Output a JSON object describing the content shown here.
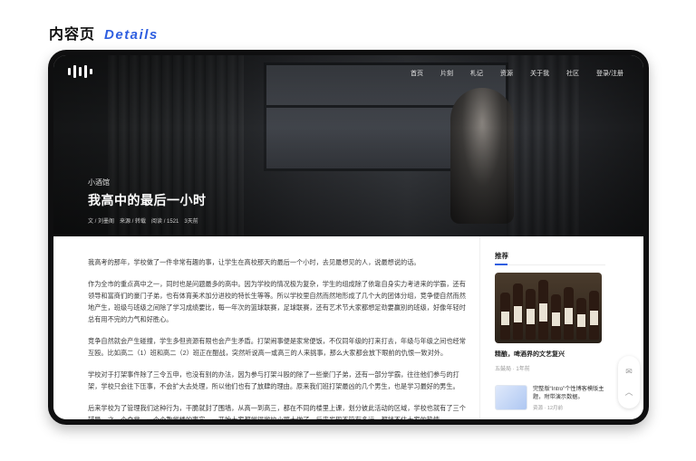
{
  "page_heading": {
    "cn": "内容页",
    "en": "Details"
  },
  "nav": {
    "items": [
      "首页",
      "片刻",
      "札记",
      "资源",
      "关于我",
      "社区",
      "登录/注册"
    ]
  },
  "hero": {
    "category": "小酒馆",
    "title": "我高中的最后一小时",
    "meta": [
      "文 / 刘墨阁",
      "来源 / 转载",
      "阅读 / 1521",
      "3天前"
    ]
  },
  "article": {
    "paragraphs": [
      "我高考的那年，学校做了一件非常有趣的事，让学生在高校那天的最后一个小时，去见最想见的人，说最想说的话。",
      "作为全市的重点高中之一，同时也是问题最多的高中。因为学校的情况极为复杂，学生的组成除了依靠自身实力考进来的学霸，还有领导和富商们的豪门子弟，也有体育美术加分进校的特长生等等。所以学校里自然而然地形成了几个大的团体分组，竞争便自然而然地产生，班级与班级之间除了学习成绩要比，每一年次的篮球联赛，足球联赛，还有艺术节大家都想足劲要赢别的班级，好像年轻时总有用不完的力气和好胜心。",
      "竞争自然就会产生碰撞，学生多但资源有限也会产生矛盾。打架闹事便是家常便饭，不仅同年级的打来打去，年级与年级之间也经常互殴。比如高二（1）班和高二（2）班正在酣战，突然听说高一或高三的人来挑事，那么大家都会放下眼前的仇恨一致对外。",
      "学校对于打架事件除了三令五申，也没有别的办法，因为参与打架斗殴的除了一些豪门子弟，还有一部分学霸，往往他们参与的打架，学校只会往下压事，不会扩大去处理，所以他们也有了放肆的理由。原来我们班打架最凶的几个男生，也是学习最好的男生。",
      "后来学校为了管理我们这种行为，干脆就封了围墙，从高一到高三，都在不同的楼里上课，划分彼此活动的区域，学校也就有了三个辅导，之一个食堂，一个个教学楼的事实，一开始大家都觉得学校小题大做了，后来发现不管有多远，都挡不住大家的热情。"
    ]
  },
  "sidebar": {
    "title": "推荐",
    "rec1": {
      "title": "精酿，啤酒界的文艺复兴",
      "author": "五鼓局",
      "time": "1年前"
    },
    "rec2": {
      "title": "完整版“Intro”个性博客模版主题，附带演示数据。",
      "author": "资源",
      "time": "12月前"
    }
  },
  "float_bar": {
    "icons": [
      "mail-icon",
      "arrow-up-icon"
    ]
  },
  "colors": {
    "accent": "#2f5fe0",
    "device": "#0f0f10"
  }
}
